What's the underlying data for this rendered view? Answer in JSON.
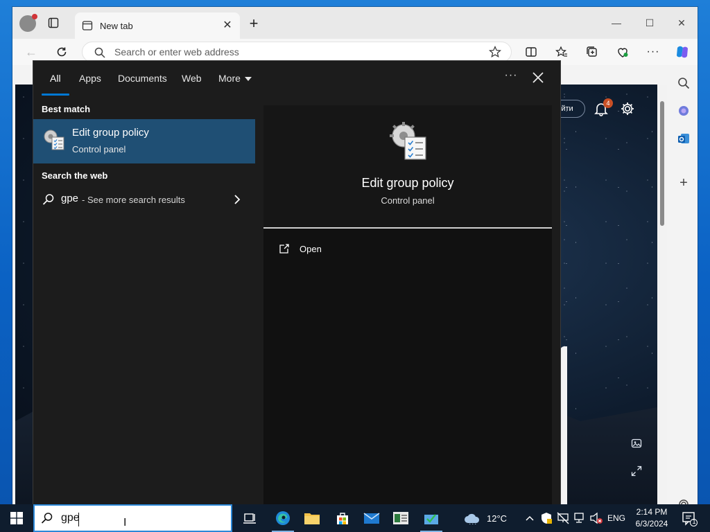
{
  "browser": {
    "tab_title": "New tab",
    "address_placeholder": "Search or enter web address",
    "signin_pill_text": "йти",
    "notification_count": "4"
  },
  "search_panel": {
    "tabs": [
      {
        "label": "All",
        "active": true
      },
      {
        "label": "Apps",
        "active": false
      },
      {
        "label": "Documents",
        "active": false
      },
      {
        "label": "Web",
        "active": false
      },
      {
        "label": "More",
        "active": false
      }
    ],
    "best_match_heading": "Best match",
    "best_match": {
      "title": "Edit group policy",
      "subtitle": "Control panel"
    },
    "search_web_heading": "Search the web",
    "web_result": {
      "query": "gpe",
      "suffix": " - See more search results"
    },
    "detail": {
      "title": "Edit group policy",
      "subtitle": "Control panel",
      "actions": [
        {
          "label": "Open",
          "icon": "open-icon"
        }
      ]
    }
  },
  "taskbar": {
    "search_value": "gpe",
    "weather_temp": "12°C",
    "language": "ENG",
    "time": "2:14 PM",
    "date": "6/3/2024",
    "notification_count": "1",
    "pinned_apps": [
      "task-view-icon",
      "edge-icon",
      "file-explorer-icon",
      "microsoft-store-icon",
      "mail-icon",
      "app-icon",
      "app-icon-2"
    ]
  },
  "colors": {
    "accent": "#0078d4",
    "selected_item": "#1f4f74",
    "panel_bg": "#1c1c1c",
    "taskbar_bg": "#0f1d2e"
  }
}
